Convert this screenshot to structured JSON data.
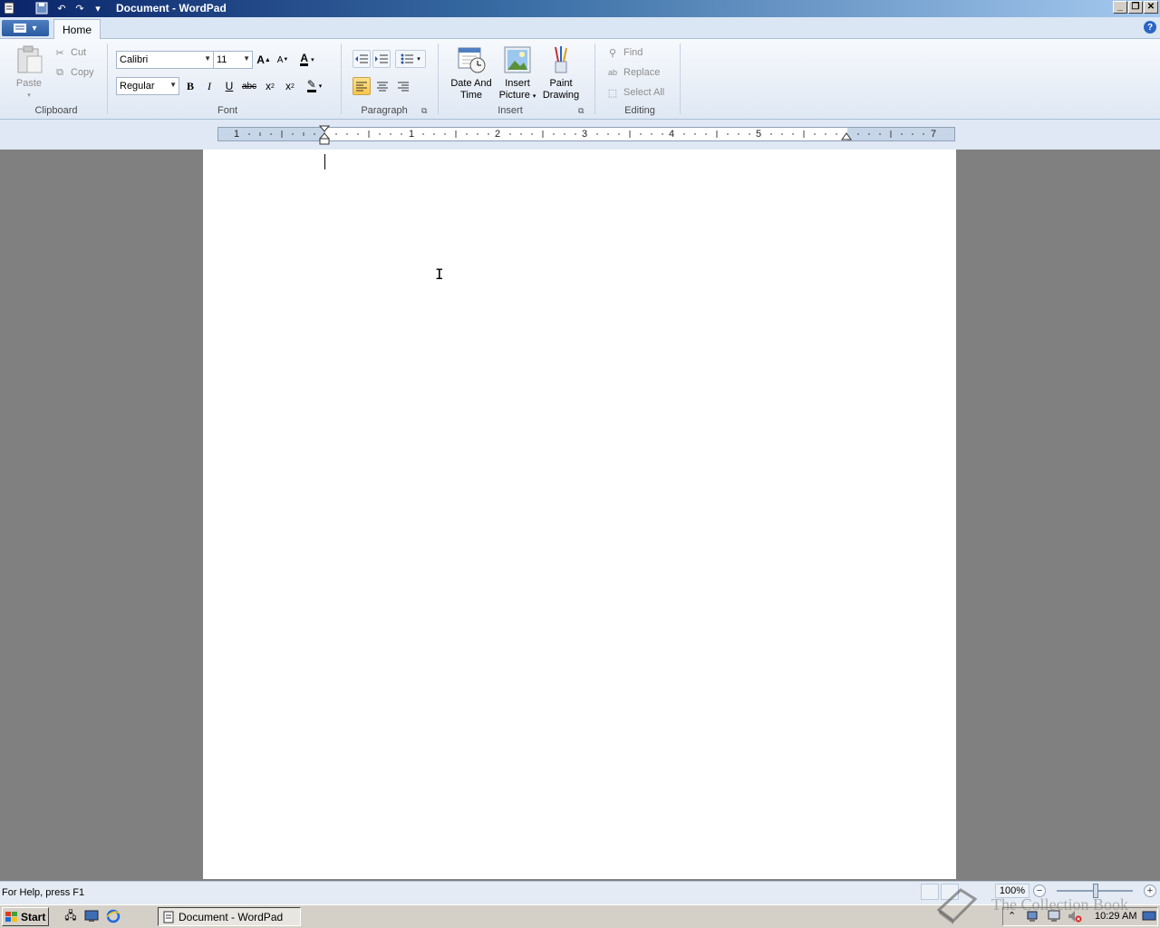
{
  "window": {
    "title": "Document - WordPad"
  },
  "ribbon": {
    "tabs": [
      {
        "label": "Home"
      }
    ],
    "clipboard": {
      "group_label": "Clipboard",
      "paste": "Paste",
      "cut": "Cut",
      "copy": "Copy"
    },
    "font": {
      "group_label": "Font",
      "family": "Calibri",
      "size": "11",
      "style": "Regular",
      "bold": "B",
      "italic": "I",
      "underline": "U",
      "strikethrough": "abc"
    },
    "paragraph": {
      "group_label": "Paragraph"
    },
    "insert": {
      "group_label": "Insert",
      "date_time": [
        "Date And",
        "Time"
      ],
      "insert_picture": [
        "Insert",
        "Picture"
      ],
      "paint_drawing": [
        "Paint",
        "Drawing"
      ]
    },
    "editing": {
      "group_label": "Editing",
      "find": "Find",
      "replace": "Replace",
      "select_all": "Select All"
    }
  },
  "ruler": {
    "numbers": [
      "1",
      "1",
      "2",
      "3",
      "4",
      "5",
      "7"
    ]
  },
  "statusbar": {
    "help": "For Help, press F1",
    "zoom": "100%"
  },
  "taskbar": {
    "start": "Start",
    "task": "Document - WordPad",
    "clock": "10:29 AM",
    "watermark": "The Collection Book"
  },
  "colors": {
    "accent": "#2a5aa0",
    "highlight_active": "#ffc64a"
  }
}
